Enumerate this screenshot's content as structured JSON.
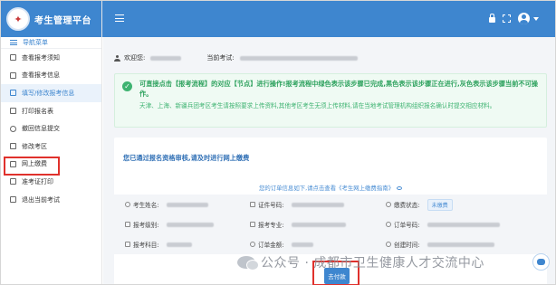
{
  "app": {
    "title": "考生管理平台",
    "brand_color": "#3e86cf"
  },
  "sidebar": {
    "menu_title": "导航菜单",
    "items": [
      {
        "label": "查看报考须知",
        "icon": "message-icon"
      },
      {
        "label": "查看报考信息",
        "icon": "card-icon"
      },
      {
        "label": "填写/修改报考信息",
        "icon": "edit-icon",
        "active": true
      },
      {
        "label": "打印报名表",
        "icon": "print-icon"
      },
      {
        "label": "撤回信息提交",
        "icon": "undo-icon"
      },
      {
        "label": "修改考区",
        "icon": "swap-icon"
      },
      {
        "label": "网上缴费",
        "icon": "document-icon",
        "highlighted": true
      },
      {
        "label": "准考证打印",
        "icon": "ticket-icon"
      },
      {
        "label": "退出当前考试",
        "icon": "exit-icon"
      }
    ]
  },
  "topbar": {
    "icons": [
      "menu-icon",
      "lock-icon",
      "fullscreen-icon",
      "user-avatar-icon"
    ]
  },
  "welcome": {
    "greeting": "欢迎您:",
    "exam_label": "当前考试:"
  },
  "notice": {
    "line1": "可直接点击【报考流程】的对应【节点】进行操作!报考流程中绿色表示该步骤已完成,黑色表示该步骤正在进行,灰色表示该步骤当前不可操作。",
    "line2": "天津、上海、新疆兵团考区考生请按照要求上传资料,其他考区考生无须上传材料,请在当地考试管理机构组织报名确认时提交相应材料。",
    "accent": "#3eb371"
  },
  "payment": {
    "title": "您已通过报名资格审核,请及时进行网上缴费",
    "hint": "您的订单信息如下,请点击查看《考生网上缴费指南》",
    "fields": {
      "name_label": "考生姓名:",
      "id_label": "证件号码:",
      "status_label": "缴费状态:",
      "status_value": "未缴费",
      "level_label": "报考级别:",
      "major_label": "报考专业:",
      "order_label": "订单号码:",
      "subject_label": "报考科目:",
      "amount_label": "订单金额:",
      "created_label": "创建时间:"
    },
    "button_label": "去付款"
  },
  "watermark": {
    "text": "公众号 · 成都市卫生健康人才交流中心"
  }
}
